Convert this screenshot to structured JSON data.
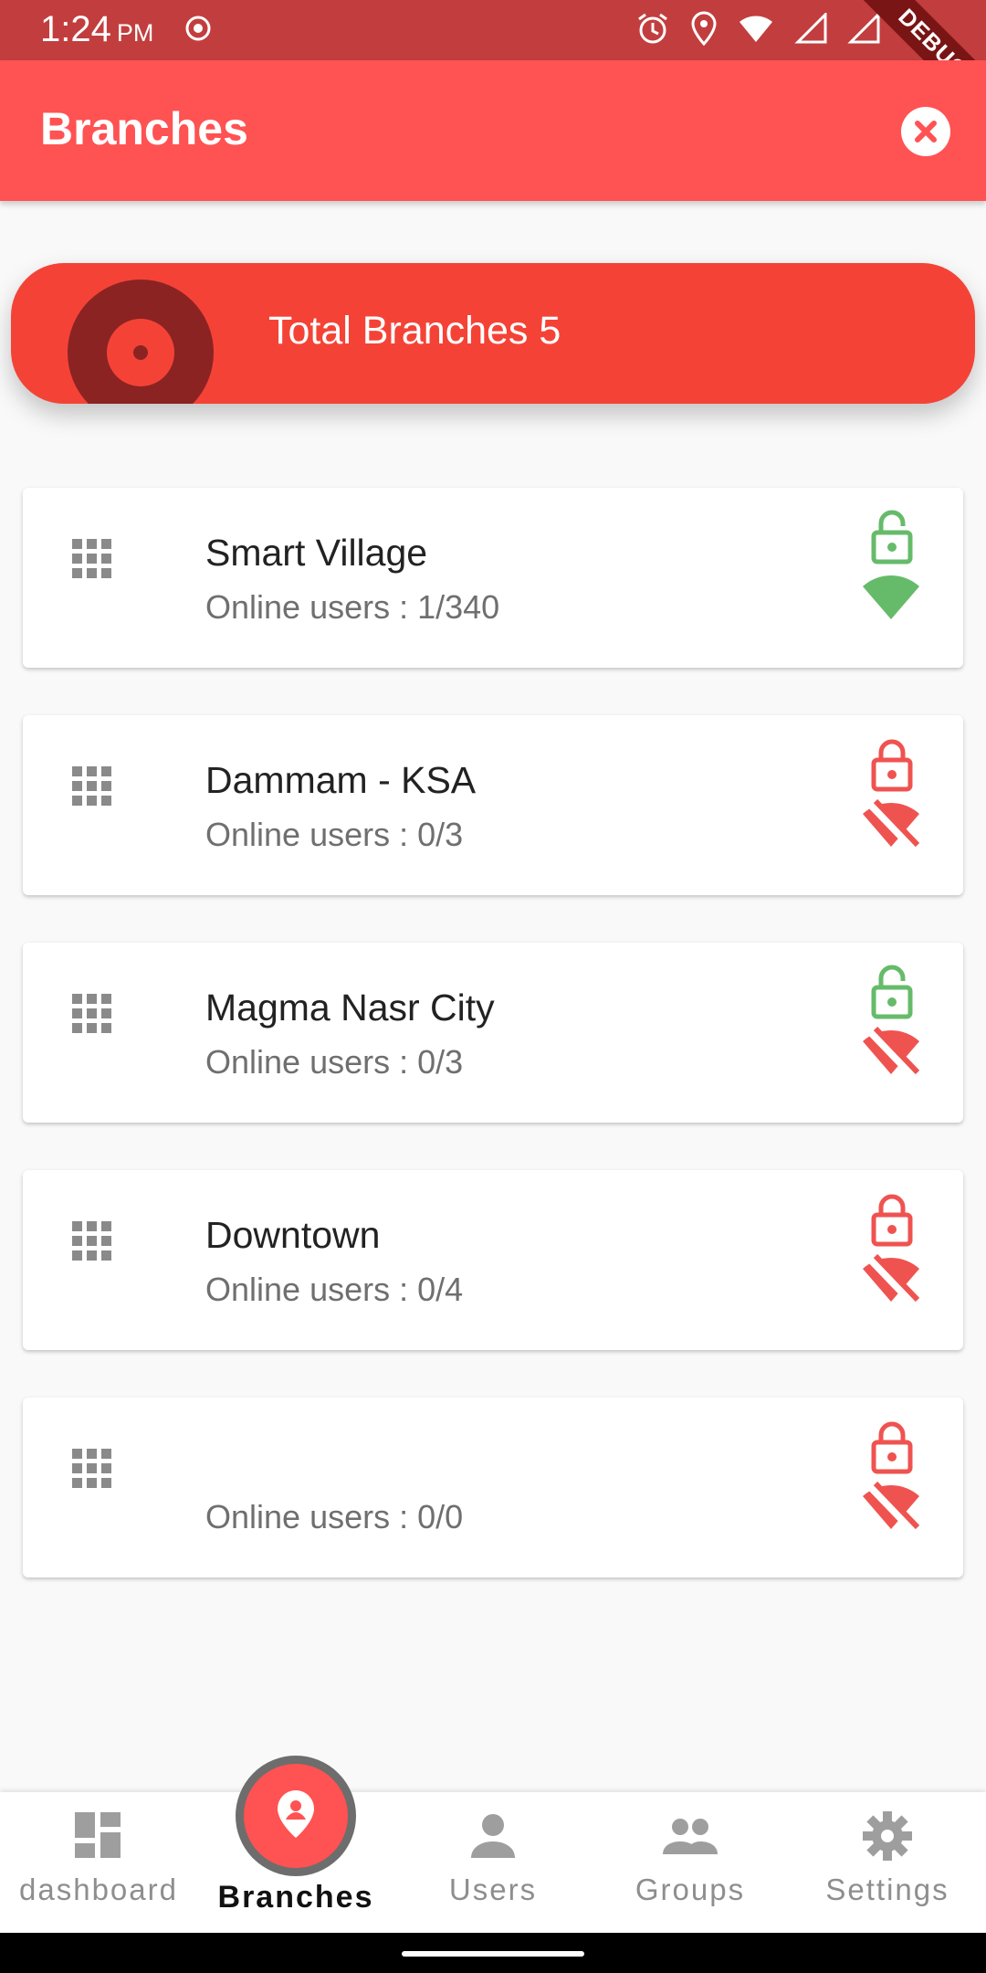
{
  "status_bar": {
    "time": "1:24",
    "ampm": "PM",
    "debug_label": "DEBUG"
  },
  "app_bar": {
    "title": "Branches"
  },
  "summary": {
    "label": "Total Branches 5"
  },
  "branches": [
    {
      "name": "Smart Village",
      "online_label": "Online users : ",
      "online_value": "1/340",
      "locked": false,
      "connected": true
    },
    {
      "name": "Dammam - KSA",
      "online_label": "Online users : ",
      "online_value": "0/3",
      "locked": true,
      "connected": false
    },
    {
      "name": "Magma Nasr City",
      "online_label": "Online users : ",
      "online_value": "0/3",
      "locked": false,
      "connected": false
    },
    {
      "name": "Downtown",
      "online_label": "Online users : ",
      "online_value": "0/4",
      "locked": true,
      "connected": false
    },
    {
      "name": "",
      "online_label": "Online users : ",
      "online_value": "0/0",
      "locked": true,
      "connected": false
    }
  ],
  "bottom_nav": {
    "items": [
      {
        "label": "dashboard",
        "icon": "dashboard-icon"
      },
      {
        "label": "Branches",
        "icon": "location-pin-icon",
        "active": true
      },
      {
        "label": "Users",
        "icon": "person-icon"
      },
      {
        "label": "Groups",
        "icon": "group-icon"
      },
      {
        "label": "Settings",
        "icon": "gear-icon"
      }
    ]
  },
  "colors": {
    "app_bar": "#ff5252",
    "status_bar": "#c23e3e",
    "summary": "#f44336",
    "ok_green": "#66bb6a",
    "alert_red": "#ef5350",
    "muted_grey": "#8e8e8e"
  }
}
